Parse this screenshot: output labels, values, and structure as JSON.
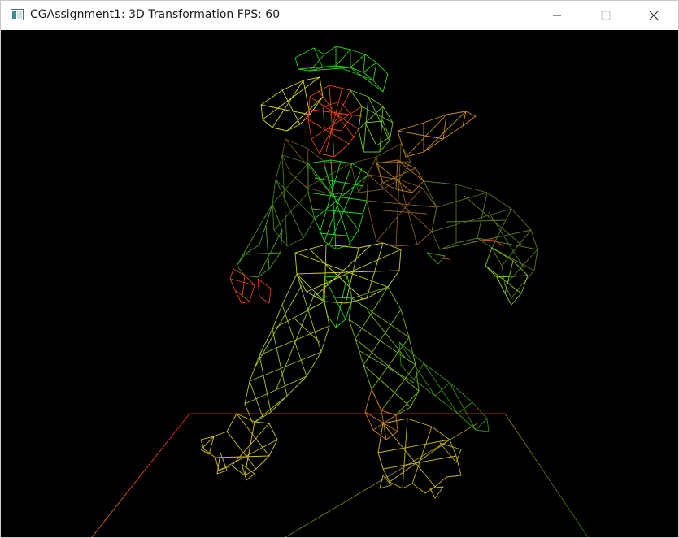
{
  "window": {
    "title": "CGAssignment1: 3D Transformation FPS: 60",
    "controls": {
      "minimize_icon": "minimize-icon",
      "maximize_icon": "maximize-icon",
      "close_icon": "close-icon"
    }
  },
  "scene": {
    "background_color": "#000000",
    "ground_plane_colors": [
      "#e0221a",
      "#c86a10",
      "#8a8a10",
      "#1f6a10"
    ],
    "model_palette": [
      "#2bd12b",
      "#7ad41c",
      "#d6d61a",
      "#d9471b",
      "#8b5a1e"
    ]
  }
}
